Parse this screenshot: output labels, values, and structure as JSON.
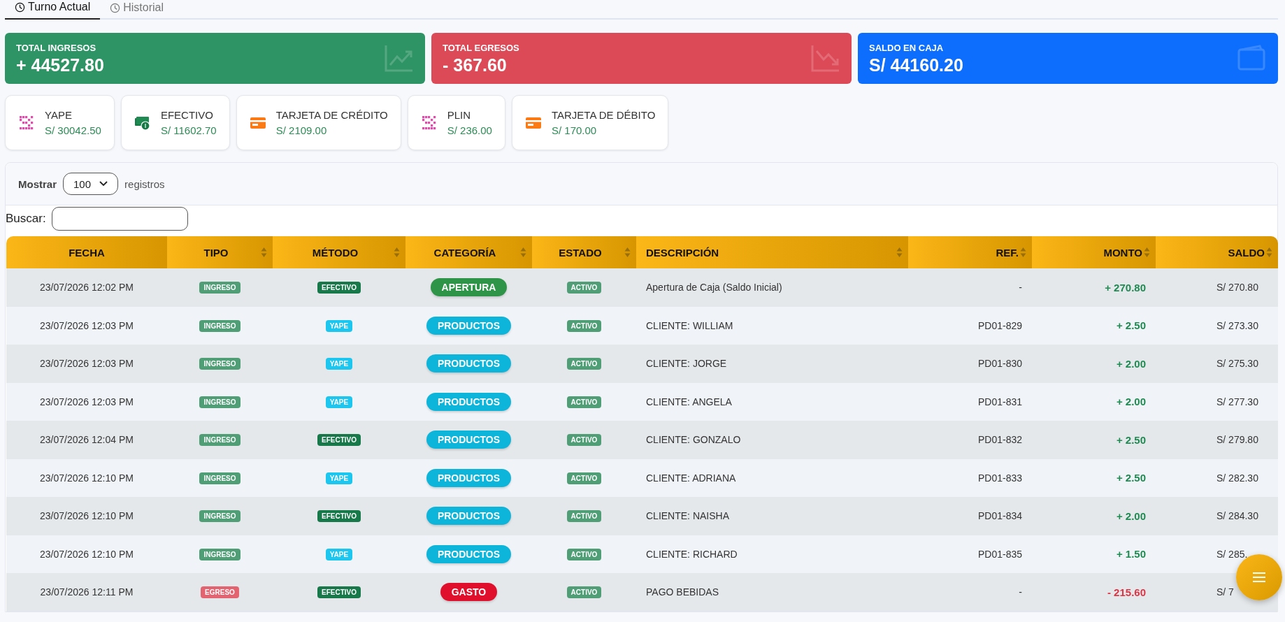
{
  "tabs": [
    {
      "label": "Turno Actual",
      "selected": true
    },
    {
      "label": "Historial",
      "selected": false
    }
  ],
  "summary_cards": [
    {
      "label": "TOTAL INGRESOS",
      "value": "+ 44527.80",
      "kind": "ingresos"
    },
    {
      "label": "TOTAL EGRESOS",
      "value": "- 367.60",
      "kind": "egresos"
    },
    {
      "label": "SALDO EN CAJA",
      "value": "S/ 44160.20",
      "kind": "saldo"
    }
  ],
  "payment_methods": [
    {
      "label": "YAPE",
      "amount": "S/ 30042.50",
      "kind": "qr"
    },
    {
      "label": "EFECTIVO",
      "amount": "S/ 11602.70",
      "kind": "cash"
    },
    {
      "label": "TARJETA DE CRÉDITO",
      "amount": "S/ 2109.00",
      "kind": "card"
    },
    {
      "label": "PLIN",
      "amount": "S/ 236.00",
      "kind": "qr"
    },
    {
      "label": "TARJETA DE DÉBITO",
      "amount": "S/ 170.00",
      "kind": "card"
    }
  ],
  "length_control": {
    "label": "Mostrar",
    "value": "100",
    "suffix": "registros"
  },
  "search": {
    "label": "Buscar:"
  },
  "table": {
    "columns": [
      {
        "label": "FECHA",
        "sortable": false
      },
      {
        "label": "TIPO",
        "sortable": true
      },
      {
        "label": "MÉTODO",
        "sortable": true
      },
      {
        "label": "CATEGORÍA",
        "sortable": true
      },
      {
        "label": "ESTADO",
        "sortable": true
      },
      {
        "label": "DESCRIPCIÓN",
        "sortable": true
      },
      {
        "label": "REF.",
        "sortable": true
      },
      {
        "label": "MONTO",
        "sortable": true
      },
      {
        "label": "SALDO",
        "sortable": true
      }
    ],
    "rows": [
      {
        "fecha": "23/07/2026 12:02 PM",
        "tipo": {
          "label": "INGRESO",
          "kind": "ingreso"
        },
        "metodo": {
          "label": "EFECTIVO",
          "kind": "efectivo"
        },
        "categoria": {
          "label": "APERTURA",
          "kind": "apertura"
        },
        "estado": {
          "label": "ACTIVO",
          "kind": "activo"
        },
        "descripcion": "Apertura de Caja (Saldo Inicial)",
        "ref": "-",
        "monto": "+ 270.80",
        "saldo": "S/ 270.80"
      },
      {
        "fecha": "23/07/2026 12:03 PM",
        "tipo": {
          "label": "INGRESO",
          "kind": "ingreso"
        },
        "metodo": {
          "label": "YAPE",
          "kind": "yape"
        },
        "categoria": {
          "label": "PRODUCTOS",
          "kind": "productos"
        },
        "estado": {
          "label": "ACTIVO",
          "kind": "activo"
        },
        "descripcion": "CLIENTE: WILLIAM",
        "ref": "PD01-829",
        "monto": "+ 2.50",
        "saldo": "S/ 273.30"
      },
      {
        "fecha": "23/07/2026 12:03 PM",
        "tipo": {
          "label": "INGRESO",
          "kind": "ingreso"
        },
        "metodo": {
          "label": "YAPE",
          "kind": "yape"
        },
        "categoria": {
          "label": "PRODUCTOS",
          "kind": "productos"
        },
        "estado": {
          "label": "ACTIVO",
          "kind": "activo"
        },
        "descripcion": "CLIENTE: JORGE",
        "ref": "PD01-830",
        "monto": "+ 2.00",
        "saldo": "S/ 275.30"
      },
      {
        "fecha": "23/07/2026 12:03 PM",
        "tipo": {
          "label": "INGRESO",
          "kind": "ingreso"
        },
        "metodo": {
          "label": "YAPE",
          "kind": "yape"
        },
        "categoria": {
          "label": "PRODUCTOS",
          "kind": "productos"
        },
        "estado": {
          "label": "ACTIVO",
          "kind": "activo"
        },
        "descripcion": "CLIENTE: ANGELA",
        "ref": "PD01-831",
        "monto": "+ 2.00",
        "saldo": "S/ 277.30"
      },
      {
        "fecha": "23/07/2026 12:04 PM",
        "tipo": {
          "label": "INGRESO",
          "kind": "ingreso"
        },
        "metodo": {
          "label": "EFECTIVO",
          "kind": "efectivo"
        },
        "categoria": {
          "label": "PRODUCTOS",
          "kind": "productos"
        },
        "estado": {
          "label": "ACTIVO",
          "kind": "activo"
        },
        "descripcion": "CLIENTE: GONZALO",
        "ref": "PD01-832",
        "monto": "+ 2.50",
        "saldo": "S/ 279.80"
      },
      {
        "fecha": "23/07/2026 12:10 PM",
        "tipo": {
          "label": "INGRESO",
          "kind": "ingreso"
        },
        "metodo": {
          "label": "YAPE",
          "kind": "yape"
        },
        "categoria": {
          "label": "PRODUCTOS",
          "kind": "productos"
        },
        "estado": {
          "label": "ACTIVO",
          "kind": "activo"
        },
        "descripcion": "CLIENTE: ADRIANA",
        "ref": "PD01-833",
        "monto": "+ 2.50",
        "saldo": "S/ 282.30"
      },
      {
        "fecha": "23/07/2026 12:10 PM",
        "tipo": {
          "label": "INGRESO",
          "kind": "ingreso"
        },
        "metodo": {
          "label": "EFECTIVO",
          "kind": "efectivo"
        },
        "categoria": {
          "label": "PRODUCTOS",
          "kind": "productos"
        },
        "estado": {
          "label": "ACTIVO",
          "kind": "activo"
        },
        "descripcion": "CLIENTE: NAISHA",
        "ref": "PD01-834",
        "monto": "+ 2.00",
        "saldo": "S/ 284.30"
      },
      {
        "fecha": "23/07/2026 12:10 PM",
        "tipo": {
          "label": "INGRESO",
          "kind": "ingreso"
        },
        "metodo": {
          "label": "YAPE",
          "kind": "yape"
        },
        "categoria": {
          "label": "PRODUCTOS",
          "kind": "productos"
        },
        "estado": {
          "label": "ACTIVO",
          "kind": "activo"
        },
        "descripcion": "CLIENTE: RICHARD",
        "ref": "PD01-835",
        "monto": "+ 1.50",
        "saldo": "S/ 285."
      },
      {
        "fecha": "23/07/2026 12:11 PM",
        "tipo": {
          "label": "EGRESO",
          "kind": "egreso"
        },
        "metodo": {
          "label": "EFECTIVO",
          "kind": "efectivo"
        },
        "categoria": {
          "label": "GASTO",
          "kind": "gasto"
        },
        "estado": {
          "label": "ACTIVO",
          "kind": "activo"
        },
        "descripcion": "PAGO BEBIDAS",
        "ref": "-",
        "monto": "- 215.60",
        "saldo": "S/ 7"
      }
    ]
  }
}
